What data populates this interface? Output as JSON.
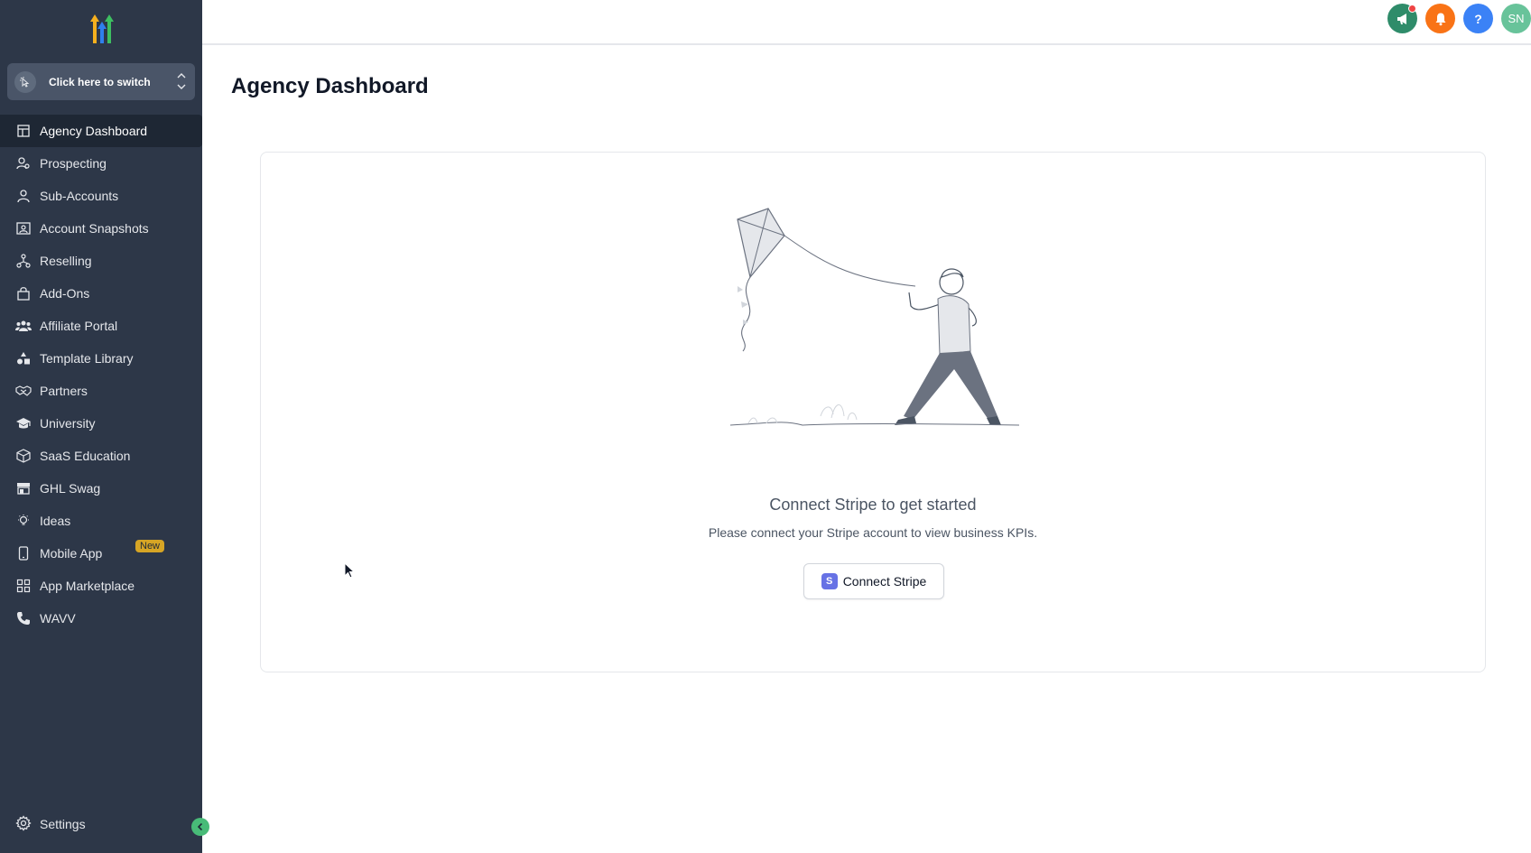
{
  "sidebar": {
    "switcher_label": "Click here to switch",
    "items": [
      {
        "label": "Agency Dashboard",
        "icon": "dashboard-icon",
        "active": true
      },
      {
        "label": "Prospecting",
        "icon": "prospecting-icon"
      },
      {
        "label": "Sub-Accounts",
        "icon": "user-icon"
      },
      {
        "label": "Account Snapshots",
        "icon": "snapshot-icon"
      },
      {
        "label": "Reselling",
        "icon": "reselling-icon"
      },
      {
        "label": "Add-Ons",
        "icon": "bag-icon"
      },
      {
        "label": "Affiliate Portal",
        "icon": "users-icon"
      },
      {
        "label": "Template Library",
        "icon": "shapes-icon"
      },
      {
        "label": "Partners",
        "icon": "handshake-icon"
      },
      {
        "label": "University",
        "icon": "graduation-cap-icon"
      },
      {
        "label": "SaaS Education",
        "icon": "cube-icon"
      },
      {
        "label": "GHL Swag",
        "icon": "store-icon"
      },
      {
        "label": "Ideas",
        "icon": "lightbulb-icon"
      },
      {
        "label": "Mobile App",
        "icon": "mobile-icon",
        "badge": "New"
      },
      {
        "label": "App Marketplace",
        "icon": "grid-icon"
      },
      {
        "label": "WAVV",
        "icon": "phone-icon"
      }
    ],
    "settings_label": "Settings"
  },
  "topbar": {
    "avatar_initials": "SN",
    "help_label": "?"
  },
  "main": {
    "page_title": "Agency Dashboard",
    "empty_title": "Connect Stripe to get started",
    "empty_subtitle": "Please connect your Stripe account to view business KPIs.",
    "connect_button": "Connect Stripe",
    "stripe_icon_letter": "S"
  },
  "colors": {
    "sidebar_bg": "#2d3748",
    "active_item_bg": "#1e2734",
    "badge_bg": "#d6a525",
    "announce": "#2f8c6a",
    "notification": "#f97316",
    "help": "#3b82f6",
    "avatar": "#68c39a",
    "collapse": "#48bb78",
    "stripe": "#6772e5"
  }
}
